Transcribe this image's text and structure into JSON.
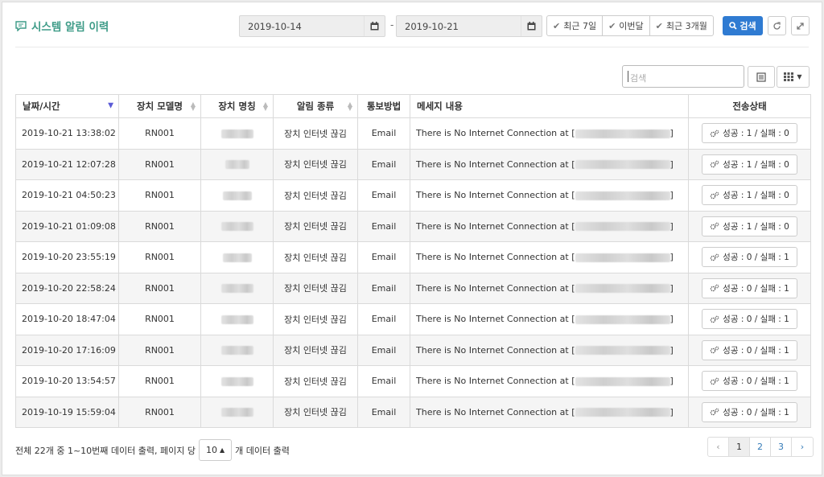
{
  "header": {
    "title": "시스템 알림 이력",
    "start_date": "2019-10-14",
    "date_separator": "-",
    "end_date": "2019-10-21",
    "range_buttons": [
      "최근 7일",
      "이번달",
      "최근 3개월"
    ],
    "search_button": "검색"
  },
  "toolbar": {
    "search_placeholder": "검색"
  },
  "table": {
    "columns": [
      "날짜/시간",
      "장치 모델명",
      "장치 명칭",
      "알림 종류",
      "통보방법",
      "메세지 내용",
      "전송상태"
    ],
    "rows": [
      {
        "datetime": "2019-10-21 13:38:02",
        "model": "RN001",
        "alert": "장치 인터넷 끊김",
        "method": "Email",
        "message": "There is No Internet Connection at [",
        "close": "]",
        "status": "성공 : 1 / 실패 : 0"
      },
      {
        "datetime": "2019-10-21 12:07:28",
        "model": "RN001",
        "alert": "장치 인터넷 끊김",
        "method": "Email",
        "message": "There is No Internet Connection at [",
        "close": "]",
        "status": "성공 : 1 / 실패 : 0"
      },
      {
        "datetime": "2019-10-21 04:50:23",
        "model": "RN001",
        "alert": "장치 인터넷 끊김",
        "method": "Email",
        "message": "There is No Internet Connection at [",
        "close": "]",
        "status": "성공 : 1 / 실패 : 0"
      },
      {
        "datetime": "2019-10-21 01:09:08",
        "model": "RN001",
        "alert": "장치 인터넷 끊김",
        "method": "Email",
        "message": "There is No Internet Connection at [",
        "close": "]",
        "status": "성공 : 1 / 실패 : 0"
      },
      {
        "datetime": "2019-10-20 23:55:19",
        "model": "RN001",
        "alert": "장치 인터넷 끊김",
        "method": "Email",
        "message": "There is No Internet Connection at [",
        "close": "]",
        "status": "성공 : 0 / 실패 : 1"
      },
      {
        "datetime": "2019-10-20 22:58:24",
        "model": "RN001",
        "alert": "장치 인터넷 끊김",
        "method": "Email",
        "message": "There is No Internet Connection at [",
        "close": "]",
        "status": "성공 : 0 / 실패 : 1"
      },
      {
        "datetime": "2019-10-20 18:47:04",
        "model": "RN001",
        "alert": "장치 인터넷 끊김",
        "method": "Email",
        "message": "There is No Internet Connection at [",
        "close": "]",
        "status": "성공 : 0 / 실패 : 1"
      },
      {
        "datetime": "2019-10-20 17:16:09",
        "model": "RN001",
        "alert": "장치 인터넷 끊김",
        "method": "Email",
        "message": "There is No Internet Connection at [",
        "close": "]",
        "status": "성공 : 0 / 실패 : 1"
      },
      {
        "datetime": "2019-10-20 13:54:57",
        "model": "RN001",
        "alert": "장치 인터넷 끊김",
        "method": "Email",
        "message": "There is No Internet Connection at [",
        "close": "]",
        "status": "성공 : 0 / 실패 : 1"
      },
      {
        "datetime": "2019-10-19 15:59:04",
        "model": "RN001",
        "alert": "장치 인터넷 끊김",
        "method": "Email",
        "message": "There is No Internet Connection at [",
        "close": "]",
        "status": "성공 : 0 / 실패 : 1"
      }
    ]
  },
  "footer": {
    "summary": "전체 22개 중 1~10번째 데이터 출력, 페이지 당",
    "page_size": "10",
    "suffix": "개 데이터 출력",
    "pages": [
      "‹",
      "1",
      "2",
      "3",
      "›"
    ],
    "current_page": "1"
  },
  "colors": {
    "accent": "#3d9b87",
    "primary": "#2f7bd2",
    "sort_active": "#5b5bd6"
  }
}
